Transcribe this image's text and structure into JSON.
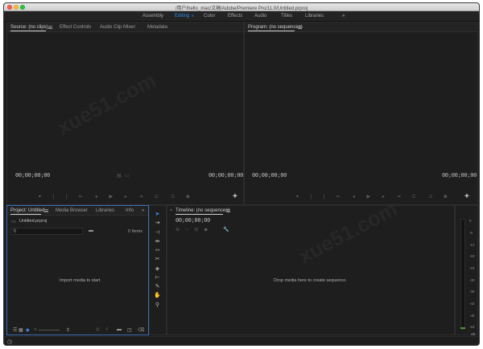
{
  "window": {
    "title": "/用户/hello_mac/文稿/Adobe/Premiere Pro/11.0/Untitled.prproj"
  },
  "workspaces": {
    "items": [
      "Assembly",
      "Editing",
      "Color",
      "Effects",
      "Audio",
      "Titles",
      "Libraries"
    ],
    "active": "Editing",
    "overflow": "»",
    "active_color": "#2d8ceb"
  },
  "source": {
    "tabs": [
      "Source: (no clips)",
      "Effect Controls",
      "Audio Clip Mixer:",
      "Metadata"
    ],
    "timecode_left": "00;00;00;00",
    "timecode_right": "00;00;00;00"
  },
  "program": {
    "tab": "Program: (no sequences)",
    "timecode_left": "00;00;00;00",
    "timecode_right": "00;00;00;00"
  },
  "project": {
    "tabs": [
      "Project: Untitled",
      "Media Browser",
      "Libraries",
      "Info"
    ],
    "overflow": "»",
    "file": "Untitled.prproj",
    "item_count": "0 Items",
    "import_hint": "Import media to start"
  },
  "timeline": {
    "tab": "Timeline: (no sequences)",
    "timecode": "00;00;00;00",
    "drop_hint": "Drop media here to create sequence."
  },
  "meter": {
    "labels": [
      "0",
      "-6",
      "-12",
      "-18",
      "-24",
      "-30",
      "-36",
      "-42",
      "-48",
      "-54",
      "dB"
    ]
  },
  "watermark": "xue51.com"
}
